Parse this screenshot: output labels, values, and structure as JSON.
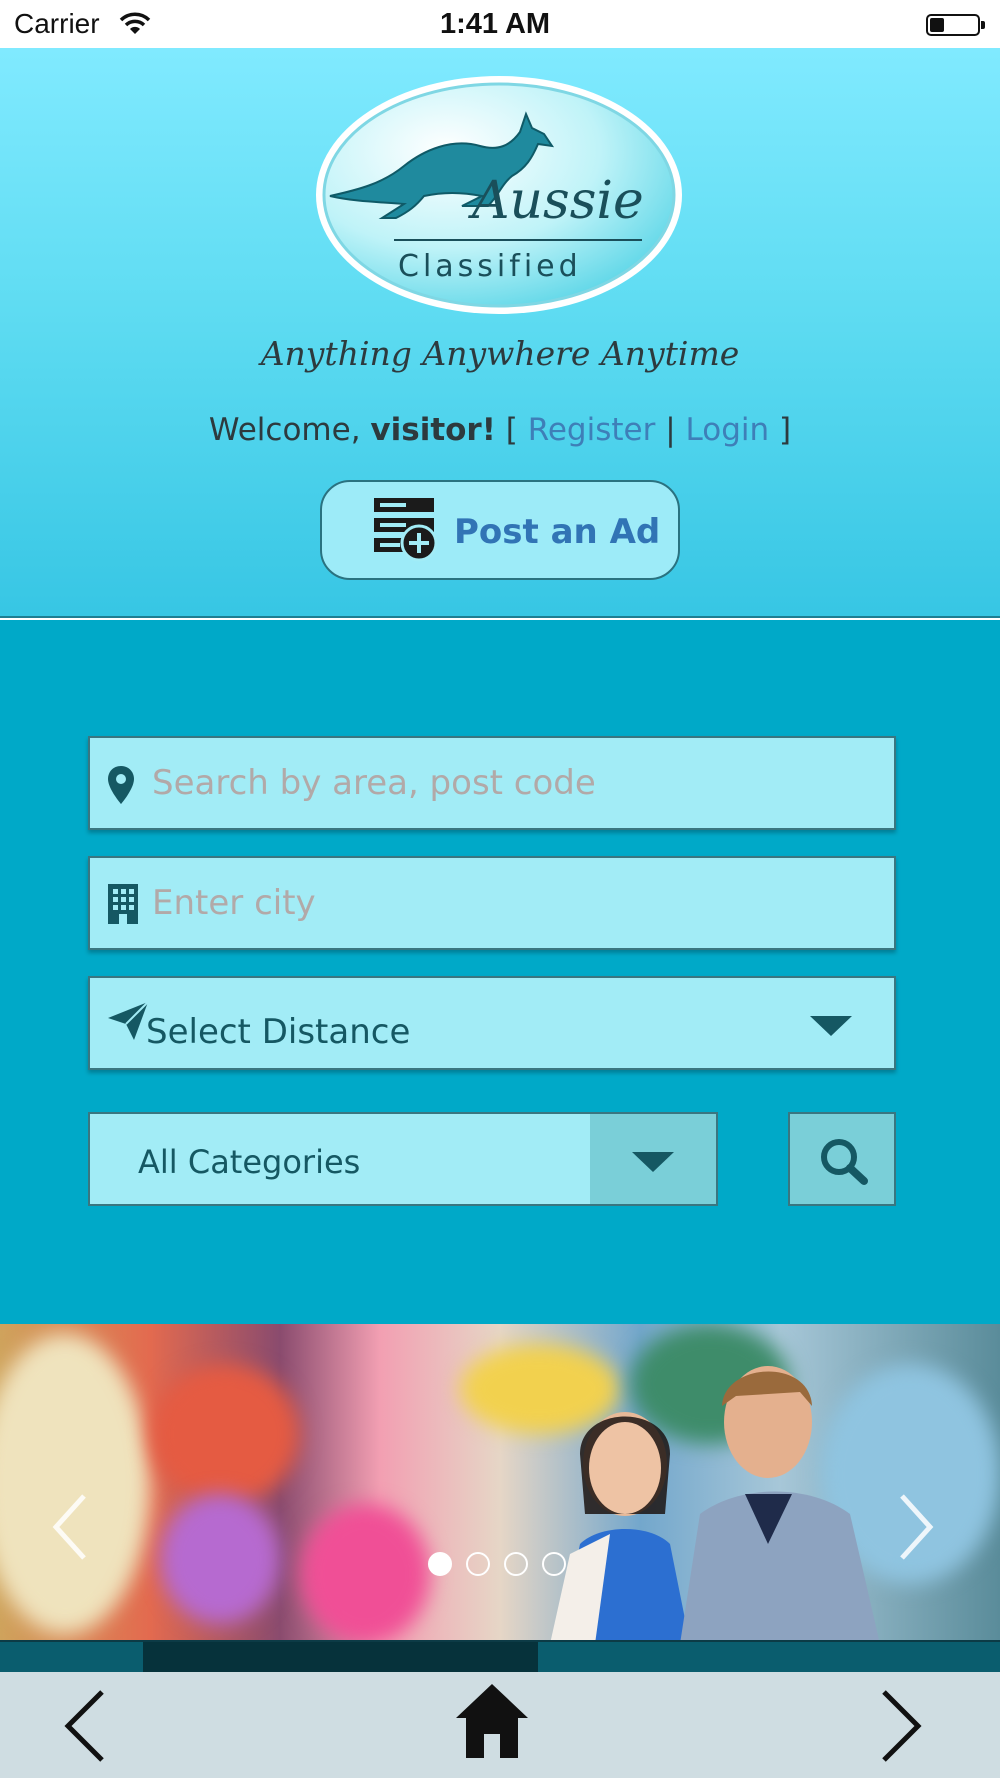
{
  "status_bar": {
    "carrier": "Carrier",
    "time": "1:41 AM"
  },
  "header": {
    "logo": {
      "brand": "Aussie",
      "sub": "Classified"
    },
    "tagline": "Anything Anywhere Anytime",
    "welcome": {
      "prefix": "Welcome,",
      "user": "visitor!",
      "open_bracket": "[",
      "register": "Register",
      "separator": "|",
      "login": "Login",
      "close_bracket": "]"
    },
    "post_ad_label": "Post an Ad"
  },
  "search": {
    "area_placeholder": "Search by area, post code",
    "city_placeholder": "Enter city",
    "distance_value": "Select Distance",
    "category_value": "All Categories"
  },
  "banner": {
    "slide_count": 4,
    "active_slide": 0,
    "progress_start_fraction": 0.143,
    "progress_end_fraction": 0.538
  },
  "colors": {
    "header_top": "#80eaff",
    "search_bg": "#00a9c8",
    "field_bg": "#a2ecf6",
    "link": "#3e7fb8",
    "dark_teal": "#155863"
  },
  "icons": {
    "wifi": "wifi-icon",
    "battery": "battery-icon",
    "post_ad": "post-ad-icon",
    "location": "location-pin-icon",
    "city": "building-icon",
    "distance": "paper-plane-icon",
    "search": "search-icon",
    "back": "chevron-left-icon",
    "home": "home-icon",
    "forward": "chevron-right-icon"
  }
}
